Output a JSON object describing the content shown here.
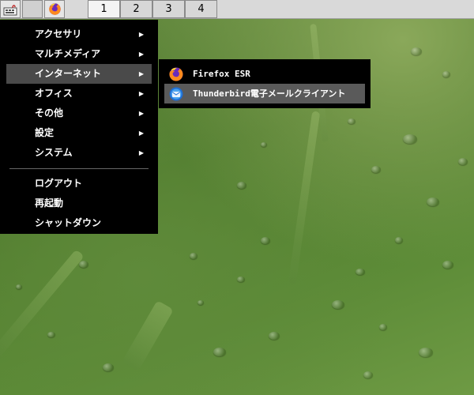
{
  "taskbar": {
    "launchers": [
      {
        "name": "app-menu-icon"
      },
      {
        "name": "empty-launcher"
      },
      {
        "name": "firefox-icon"
      }
    ],
    "desktops": [
      "1",
      "2",
      "3",
      "4"
    ],
    "active_desktop": "1"
  },
  "main_menu": {
    "items": [
      {
        "label": "アクセサリ",
        "arrow": "▶"
      },
      {
        "label": "マルチメディア",
        "arrow": "▶"
      },
      {
        "label": "インターネット",
        "arrow": "▶"
      },
      {
        "label": "オフィス",
        "arrow": "▶"
      },
      {
        "label": "その他",
        "arrow": "▶"
      },
      {
        "label": "設定",
        "arrow": "▶"
      },
      {
        "label": "システム",
        "arrow": "▶"
      }
    ],
    "actions": [
      {
        "label": "ログアウト"
      },
      {
        "label": "再起動"
      },
      {
        "label": "シャットダウン"
      }
    ]
  },
  "sub_menu": {
    "items": [
      {
        "label": "Firefox ESR",
        "icon": "firefox-icon"
      },
      {
        "label": "Thunderbird電子メールクライアント",
        "icon": "thunderbird-icon"
      }
    ]
  },
  "colors": {
    "menu_bg": "#000000",
    "menu_highlight": "#4a4a4a",
    "taskbar_bg": "#d9d9d9"
  }
}
